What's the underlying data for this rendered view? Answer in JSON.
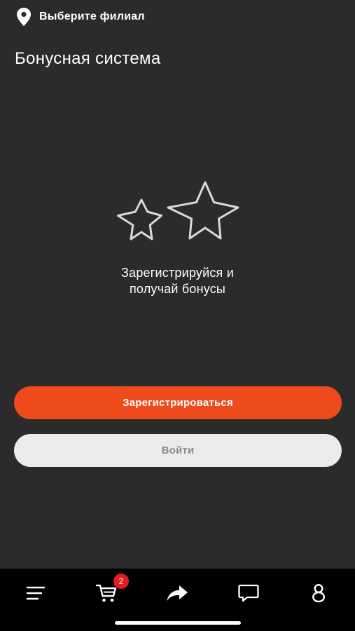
{
  "header": {
    "branch_label": "Выберите филиал",
    "branch_icon": "location-pin-icon"
  },
  "page": {
    "title": "Бонусная система"
  },
  "promo": {
    "icon": "stars-icon",
    "line1": "Зарегистрируйся и",
    "line2": "получай бонусы"
  },
  "actions": {
    "register_label": "Зарегистрироваться",
    "login_label": "Войти"
  },
  "tabbar": {
    "items": [
      {
        "name": "menu",
        "icon": "menu-icon"
      },
      {
        "name": "cart",
        "icon": "cart-icon",
        "badge": "2"
      },
      {
        "name": "share",
        "icon": "share-icon"
      },
      {
        "name": "chat",
        "icon": "chat-icon"
      },
      {
        "name": "profile",
        "icon": "profile-icon"
      }
    ]
  },
  "colors": {
    "background": "#2b2b2b",
    "accent": "#ef4a1c",
    "secondary_button": "#ebebeb",
    "tabbar": "#000000",
    "badge": "#e11d1d"
  }
}
